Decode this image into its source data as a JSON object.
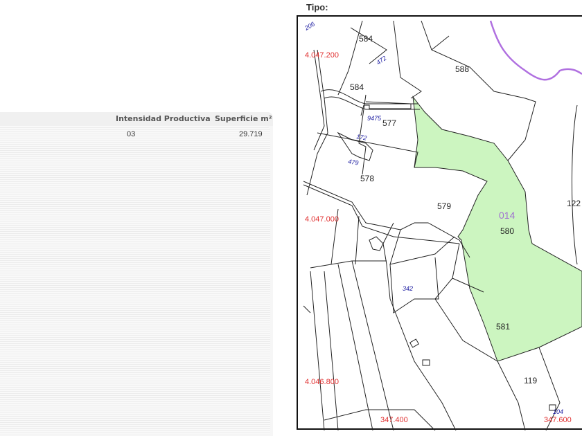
{
  "map_header": {
    "label": "Tipo:"
  },
  "table": {
    "columns": [
      "Intensidad Productiva",
      "Superficie m²"
    ],
    "rows": [
      {
        "intensidad": "03",
        "superficie": "29.719"
      }
    ]
  },
  "map": {
    "highlight_color": "#ccf5c0",
    "boundary_color": "#b070e0",
    "zone_label": "014",
    "y_coords": [
      "4.047.200",
      "4.047.000",
      "4.046.800"
    ],
    "x_coords": [
      "347.400",
      "347.600"
    ],
    "parcels": [
      "584",
      "588",
      "584",
      "577",
      "578",
      "579",
      "580",
      "122",
      "581",
      "119"
    ],
    "buildings": [
      "206",
      "472",
      "9475",
      "172",
      "479",
      "342",
      "104"
    ]
  }
}
